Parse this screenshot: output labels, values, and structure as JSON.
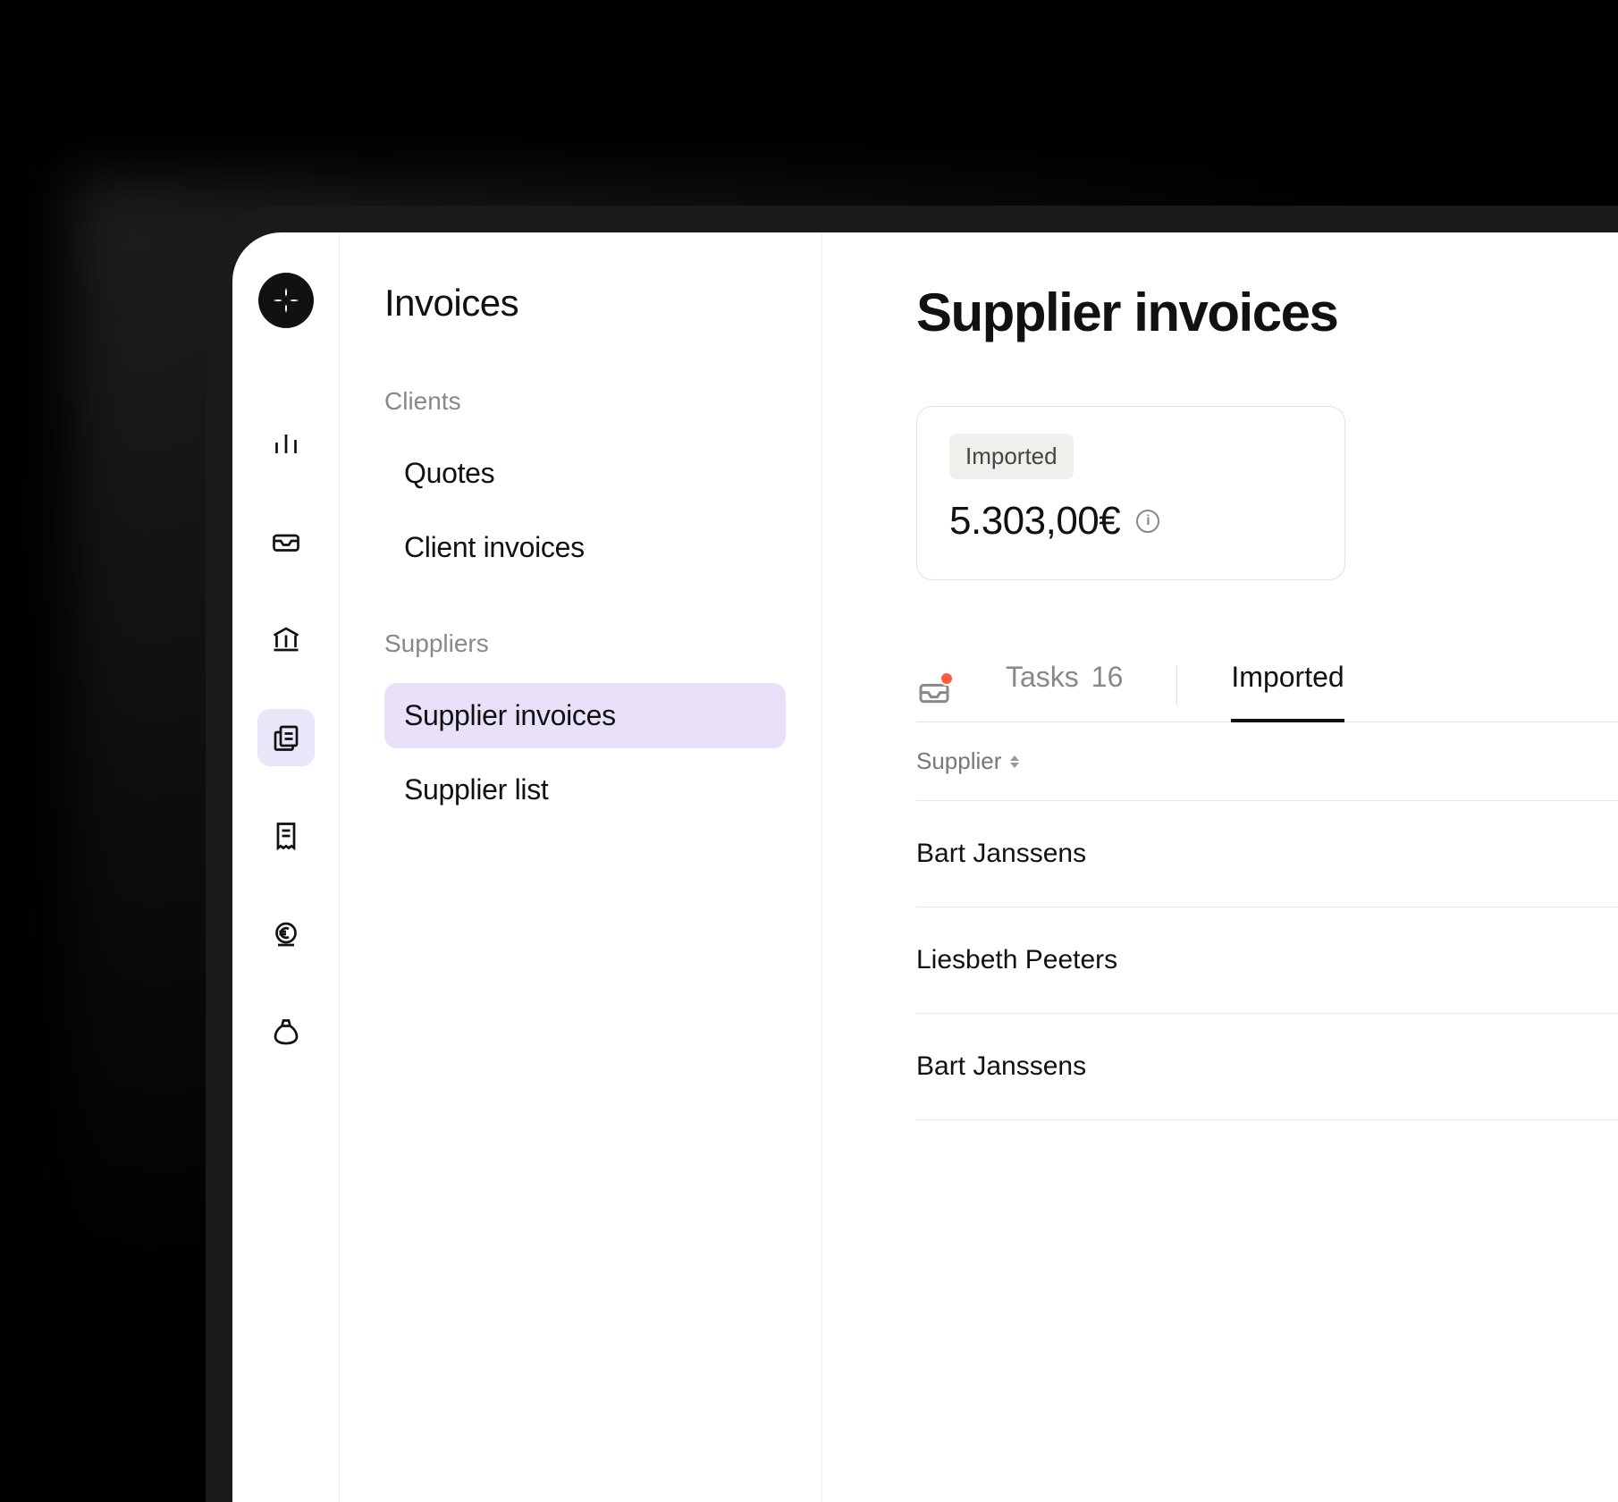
{
  "nav_title": "Invoices",
  "sections": {
    "clients": {
      "label": "Clients",
      "items": [
        {
          "label": "Quotes"
        },
        {
          "label": "Client invoices"
        }
      ]
    },
    "suppliers": {
      "label": "Suppliers",
      "items": [
        {
          "label": "Supplier invoices",
          "active": true
        },
        {
          "label": "Supplier list"
        }
      ]
    }
  },
  "page_title": "Supplier invoices",
  "summary": {
    "badge": "Imported",
    "value": "5.303,00€"
  },
  "tabs": {
    "tasks": {
      "label": "Tasks",
      "count": "16"
    },
    "imported": {
      "label": "Imported"
    }
  },
  "table": {
    "col_supplier": "Supplier",
    "rows": [
      {
        "supplier": "Bart Janssens"
      },
      {
        "supplier": "Liesbeth Peeters"
      },
      {
        "supplier": "Bart Janssens"
      }
    ]
  }
}
